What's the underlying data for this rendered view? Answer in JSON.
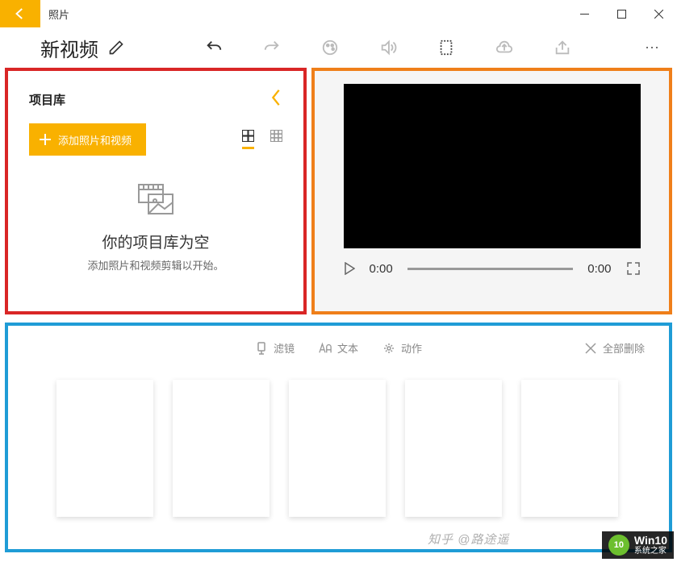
{
  "titlebar": {
    "app_name": "照片"
  },
  "toolbar": {
    "video_title": "新视频"
  },
  "library": {
    "title": "项目库",
    "add_button": "添加照片和视频",
    "empty_title": "你的项目库为空",
    "empty_sub": "添加照片和视频剪辑以开始。"
  },
  "player": {
    "time_current": "0:00",
    "time_total": "0:00"
  },
  "storyboard": {
    "filter": "滤镜",
    "text": "文本",
    "motion": "动作",
    "delete_all": "全部删除"
  },
  "watermark1": "知乎 @路途遥",
  "watermark2": {
    "brand": "Win10",
    "sub": "系统之家"
  }
}
